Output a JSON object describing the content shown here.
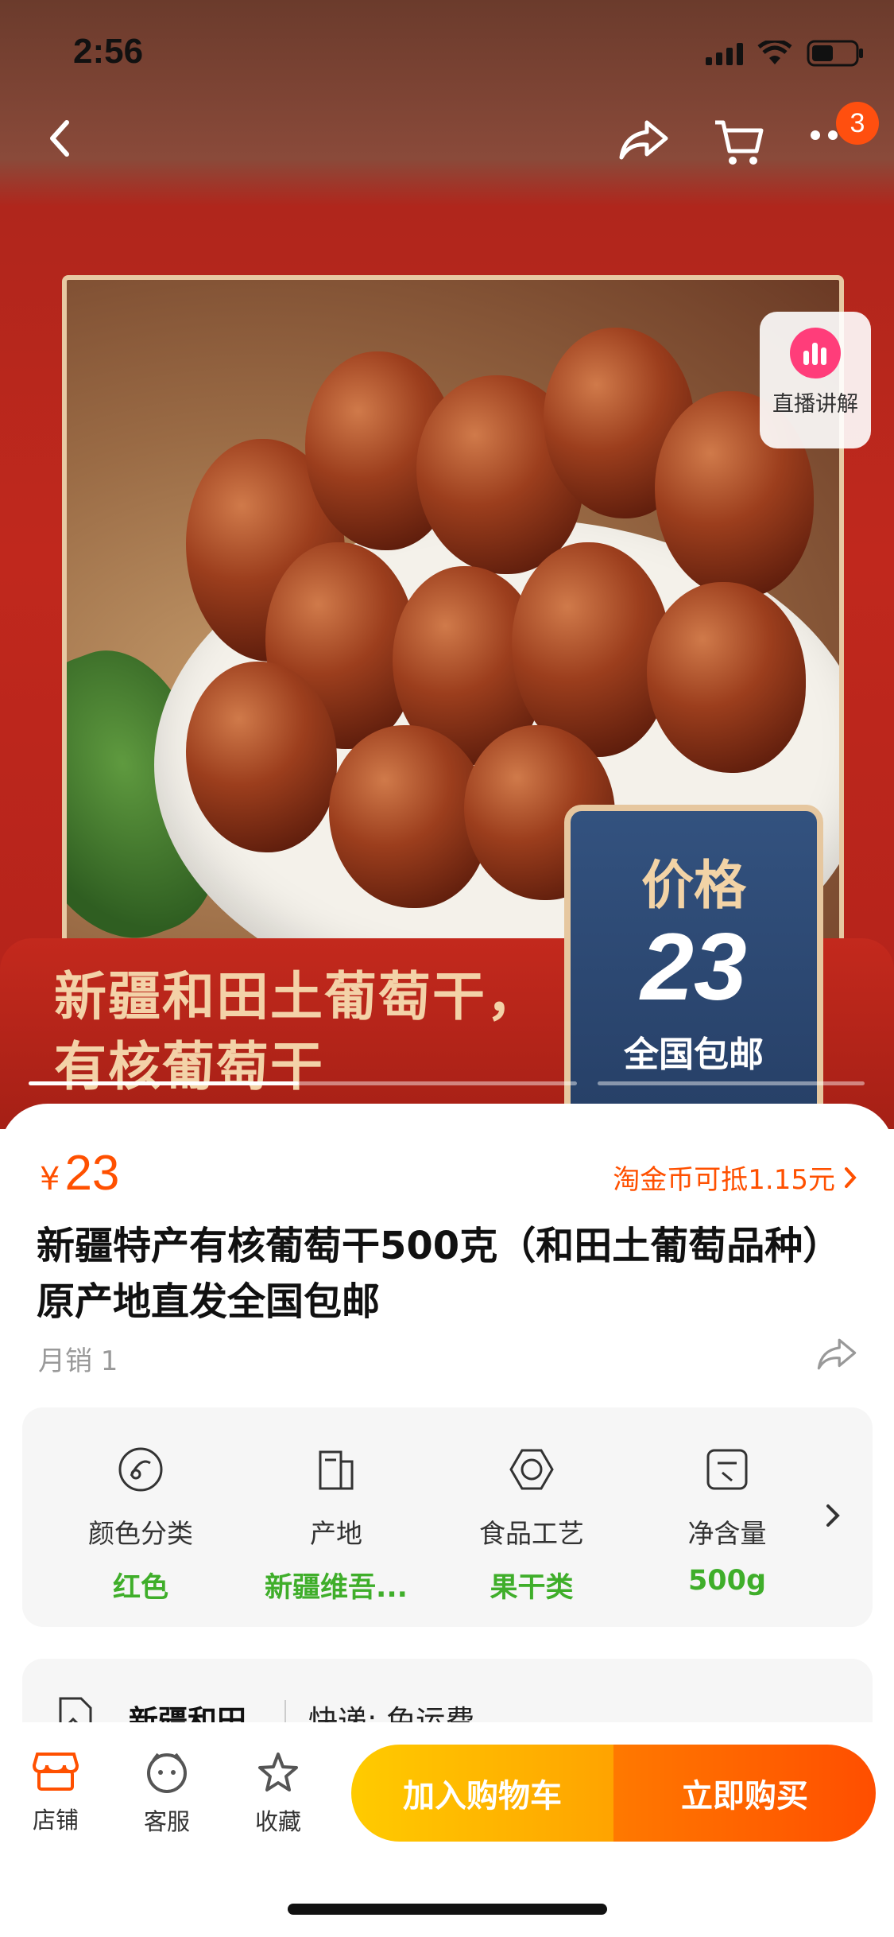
{
  "status_bar": {
    "time": "2:56"
  },
  "nav": {
    "cart_badge": "3"
  },
  "gallery": {
    "live_label": "直播讲解",
    "banner_title": "新疆和田土葡萄干，有核葡萄干",
    "price_tag": {
      "label": "价格",
      "value": "23",
      "sub": "全国包邮"
    }
  },
  "product": {
    "currency": "¥",
    "price": "23",
    "coin_text": "淘金币可抵1.15元",
    "title": "新疆特产有核葡萄干500克（和田土葡萄品种）原产地直发全国包邮",
    "sales": "月销 1"
  },
  "attributes": [
    {
      "label": "颜色分类",
      "value": "红色",
      "icon": "color-palette-icon"
    },
    {
      "label": "产地",
      "value": "新疆维吾...",
      "icon": "building-icon"
    },
    {
      "label": "食品工艺",
      "value": "果干类",
      "icon": "hexagon-icon"
    },
    {
      "label": "净含量",
      "value": "500g",
      "icon": "scale-icon"
    }
  ],
  "shipping": {
    "origin": "新疆和田",
    "text": "快递: 免运费"
  },
  "bottom_bar": {
    "store": "店铺",
    "service": "客服",
    "favorite": "收藏",
    "add_cart": "加入购物车",
    "buy_now": "立即购买"
  },
  "colors": {
    "accent": "#ff5000",
    "green": "#3fae2a",
    "banner": "#c0281d"
  }
}
